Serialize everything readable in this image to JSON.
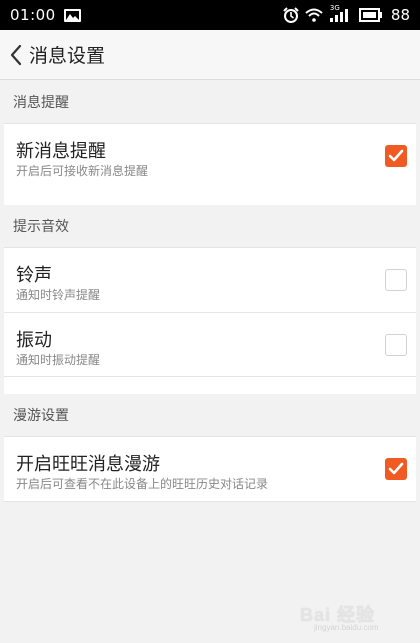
{
  "status_bar": {
    "time": "01:00",
    "network": "3G",
    "battery": "88"
  },
  "header": {
    "title": "消息设置"
  },
  "sections": [
    {
      "title": "消息提醒",
      "items": [
        {
          "title": "新消息提醒",
          "subtitle": "开启后可接收新消息提醒",
          "checked": true
        }
      ]
    },
    {
      "title": "提示音效",
      "items": [
        {
          "title": "铃声",
          "subtitle": "通知时铃声提醒",
          "checked": false
        },
        {
          "title": "振动",
          "subtitle": "通知时振动提醒",
          "checked": false
        }
      ]
    },
    {
      "title": "漫游设置",
      "items": [
        {
          "title": "开启旺旺消息漫游",
          "subtitle": "开启后可查看不在此设备上的旺旺历史对话记录",
          "checked": true
        }
      ]
    }
  ],
  "watermark": {
    "brand": "Bai 经验",
    "url": "jingyan.baidu.com"
  },
  "colors": {
    "accent": "#f05a23",
    "status_bar": "#000000",
    "background": "#f2f2f2"
  }
}
